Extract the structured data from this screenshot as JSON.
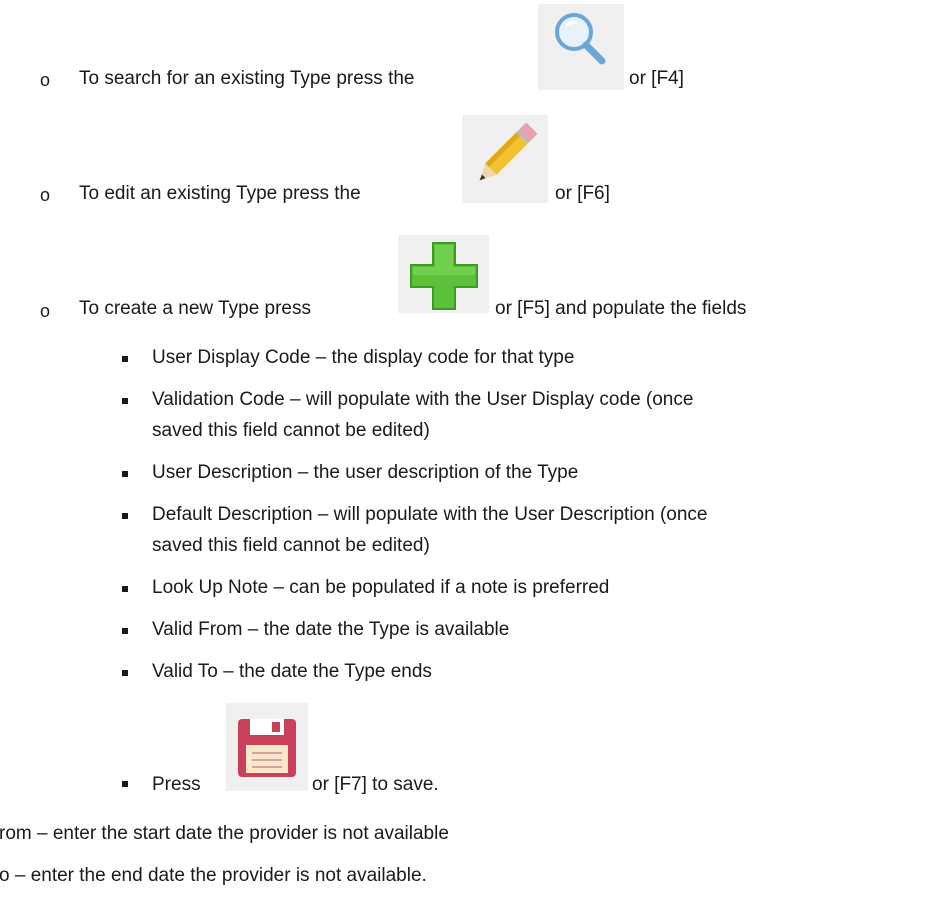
{
  "lines": {
    "search": {
      "before": "To search for an existing Type press the",
      "after": "or [F4]"
    },
    "edit": {
      "before": "To edit an existing Type press the",
      "after": "or [F6]"
    },
    "create": {
      "before": "To create a new Type press",
      "after": "or [F5] and populate the fields"
    },
    "fields": [
      "User Display Code – the display code for that type",
      "Validation Code – will populate with the User Display code (once",
      "saved this field cannot be edited)",
      "User Description – the user description of the Type",
      "Default Description – will populate with the User Description (once",
      "saved this field cannot be edited)",
      "Look Up Note – can be populated if a note is preferred",
      "Valid From – the date the Type is available",
      "Valid To – the date the Type ends"
    ],
    "save": {
      "before": "Press",
      "after": "or [F7] to save."
    },
    "partial_from": "rom – enter the start date the provider is not available",
    "partial_to": "o – enter the end date the provider is not available."
  },
  "icons": {
    "search": "magnifier-icon",
    "edit": "pencil-icon",
    "create": "green-plus-icon",
    "save": "floppy-disk-icon"
  },
  "colors": {
    "plus_green": "#5cc23a",
    "save_red": "#c9405a",
    "magnifier_blue": "#6aa6d8",
    "pencil_yellow": "#f2c230"
  }
}
